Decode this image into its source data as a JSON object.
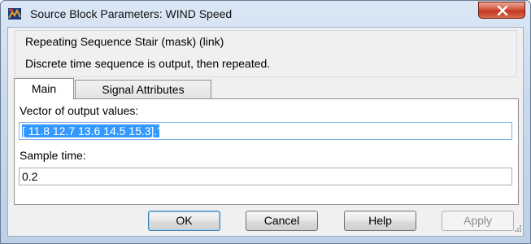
{
  "window": {
    "title": "Source Block Parameters: WIND Speed"
  },
  "mask": {
    "title": "Repeating Sequence Stair (mask) (link)",
    "description": "Discrete time sequence is output, then repeated."
  },
  "tabs": [
    {
      "label": "Main",
      "selected": true
    },
    {
      "label": "Signal Attributes",
      "selected": false
    }
  ],
  "parameters": {
    "vector_label": "Vector of output values:",
    "vector_value": "[ 11.8 12.7 13.6 14.5 15.3].'",
    "sample_label": "Sample time:",
    "sample_value": "0.2"
  },
  "buttons": {
    "ok": "OK",
    "cancel": "Cancel",
    "help": "Help",
    "apply": "Apply"
  },
  "icons": {
    "app": "simulink-block-icon",
    "close": "close-icon",
    "resize": "resize-grip-icon"
  },
  "colors": {
    "selection": "#3399ff",
    "close_button": "#c03a22",
    "title_bar": "#c9daee"
  }
}
